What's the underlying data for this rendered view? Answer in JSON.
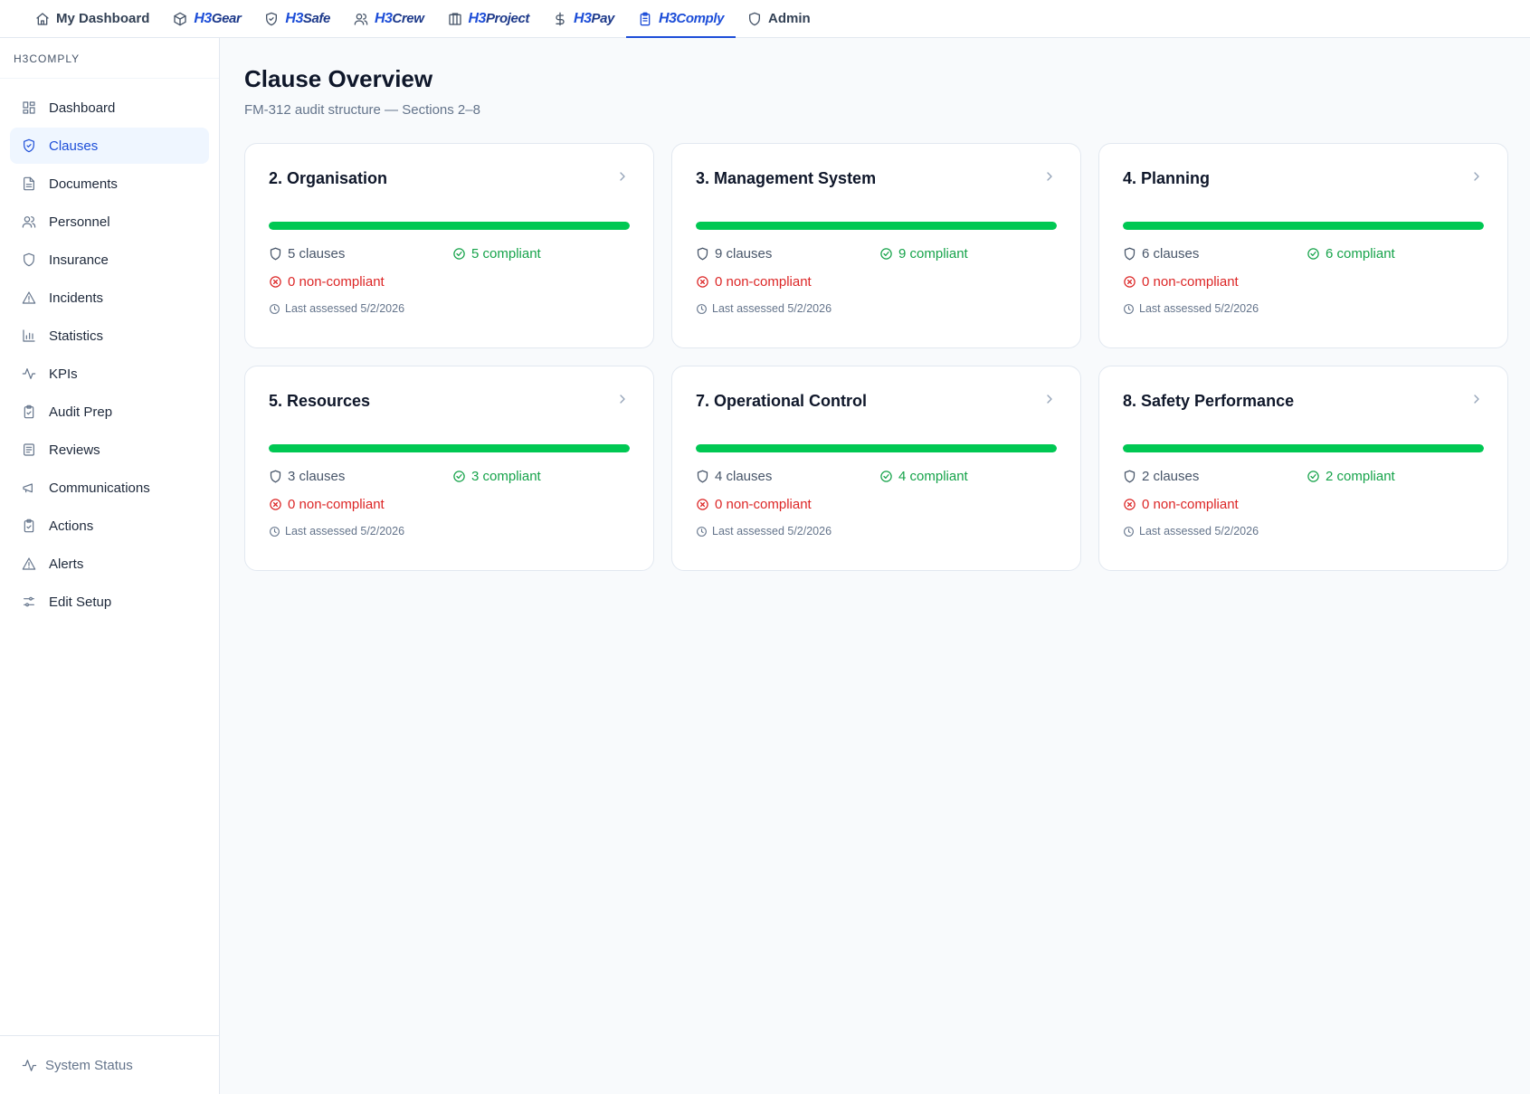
{
  "topnav": {
    "items": [
      {
        "label": "My Dashboard",
        "icon": "home-icon"
      },
      {
        "brand": "H3",
        "label": "Gear",
        "icon": "box-icon"
      },
      {
        "brand": "H3",
        "label": "Safe",
        "icon": "shield-check-icon"
      },
      {
        "brand": "H3",
        "label": "Crew",
        "icon": "users-icon"
      },
      {
        "brand": "H3",
        "label": "Project",
        "icon": "building-icon"
      },
      {
        "brand": "H3",
        "label": "Pay",
        "icon": "dollar-icon"
      },
      {
        "brand": "H3",
        "label": "Comply",
        "icon": "clipboard-icon",
        "active": true
      },
      {
        "label": "Admin",
        "icon": "shield-icon"
      }
    ]
  },
  "sidebar": {
    "section_title": "H3COMPLY",
    "items": [
      {
        "label": "Dashboard",
        "icon": "grid-icon"
      },
      {
        "label": "Clauses",
        "icon": "shield-check-icon",
        "active": true
      },
      {
        "label": "Documents",
        "icon": "file-icon"
      },
      {
        "label": "Personnel",
        "icon": "users-icon"
      },
      {
        "label": "Insurance",
        "icon": "shield-icon"
      },
      {
        "label": "Incidents",
        "icon": "warning-icon"
      },
      {
        "label": "Statistics",
        "icon": "bar-chart-icon"
      },
      {
        "label": "KPIs",
        "icon": "activity-icon"
      },
      {
        "label": "Audit Prep",
        "icon": "clipboard-check-icon"
      },
      {
        "label": "Reviews",
        "icon": "list-icon"
      },
      {
        "label": "Communications",
        "icon": "megaphone-icon"
      },
      {
        "label": "Actions",
        "icon": "clipboard-check-icon"
      },
      {
        "label": "Alerts",
        "icon": "warning-icon"
      },
      {
        "label": "Edit Setup",
        "icon": "sliders-icon"
      }
    ],
    "footer_label": "System Status"
  },
  "page": {
    "title": "Clause Overview",
    "subtitle": "FM-312 audit structure — Sections 2–8"
  },
  "cards": [
    {
      "title": "2. Organisation",
      "clauses": "5 clauses",
      "compliant": "5 compliant",
      "noncompliant": "0 non-compliant",
      "assessed": "Last assessed 5/2/2026",
      "progress": 1.0
    },
    {
      "title": "3. Management System",
      "clauses": "9 clauses",
      "compliant": "9 compliant",
      "noncompliant": "0 non-compliant",
      "assessed": "Last assessed 5/2/2026",
      "progress": 1.0
    },
    {
      "title": "4. Planning",
      "clauses": "6 clauses",
      "compliant": "6 compliant",
      "noncompliant": "0 non-compliant",
      "assessed": "Last assessed 5/2/2026",
      "progress": 1.0
    },
    {
      "title": "5. Resources",
      "clauses": "3 clauses",
      "compliant": "3 compliant",
      "noncompliant": "0 non-compliant",
      "assessed": "Last assessed 5/2/2026",
      "progress": 1.0
    },
    {
      "title": "7. Operational Control",
      "clauses": "4 clauses",
      "compliant": "4 compliant",
      "noncompliant": "0 non-compliant",
      "assessed": "Last assessed 5/2/2026",
      "progress": 1.0
    },
    {
      "title": "8. Safety Performance",
      "clauses": "2 clauses",
      "compliant": "2 compliant",
      "noncompliant": "0 non-compliant",
      "assessed": "Last assessed 5/2/2026",
      "progress": 1.0
    }
  ],
  "colors": {
    "accent": "#1d4ed8",
    "progress": "#00c853",
    "compliant": "#16a34a",
    "noncompliant": "#dc2626"
  }
}
